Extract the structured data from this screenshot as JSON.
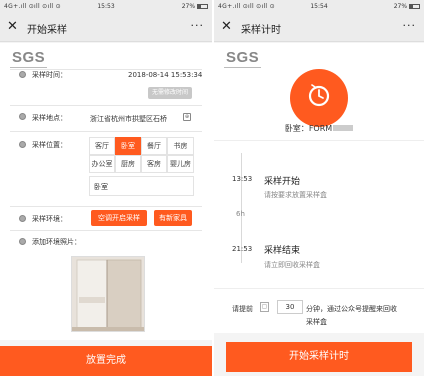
{
  "left": {
    "status": {
      "signal": "4G+.ıll ⊙ıll ⊙ıll ⊙",
      "time": "15:53",
      "battery": "27%"
    },
    "nav": {
      "title": "开始采样",
      "more": "···"
    },
    "logo": "SGS",
    "fields": {
      "time_label": "采样时间：",
      "time_value": "2018-08-14 15:53:34",
      "modify_btn": "无需修改时间",
      "location_label": "采样地点：",
      "location_value": "浙江省杭州市拱墅区石桥",
      "position_label": "采样位置：",
      "env_label": "采样环境：",
      "photo_label": "添加环境照片："
    },
    "positions": [
      "客厅",
      "卧室",
      "餐厅",
      "书房",
      "办公室",
      "厨房",
      "客房",
      "婴儿房"
    ],
    "positions_selected": "卧室",
    "position_value": "卧室",
    "env_buttons": [
      "空调开启采样",
      "有新家具"
    ],
    "submit": "放置完成"
  },
  "right": {
    "status": {
      "signal": "4G+.ıll ⊙ıll ⊙ıll ⊙",
      "time": "15:54",
      "battery": "27%"
    },
    "nav": {
      "title": "采样计时",
      "more": "···"
    },
    "logo": "SGS",
    "room_label": "卧室：",
    "room_value": "FORM",
    "timeline": [
      {
        "time": "13:53",
        "title": "采样开始",
        "desc": "请按要求放置采样盒"
      },
      {
        "time": "21:53",
        "title": "采样结束",
        "desc": "请立即回收采样盒"
      }
    ],
    "duration": "6h",
    "reminder_prefix": "请提前",
    "reminder_value": "30",
    "reminder_suffix": "分钟，通过公众号提醒来回收",
    "reminder_suffix2": "采样盒",
    "start_btn": "开始采样计时"
  },
  "colors": {
    "accent": "#ff5a1f"
  },
  "icons": [
    "close-icon",
    "more-icon",
    "location-icon",
    "calendar-icon",
    "timer-icon"
  ]
}
